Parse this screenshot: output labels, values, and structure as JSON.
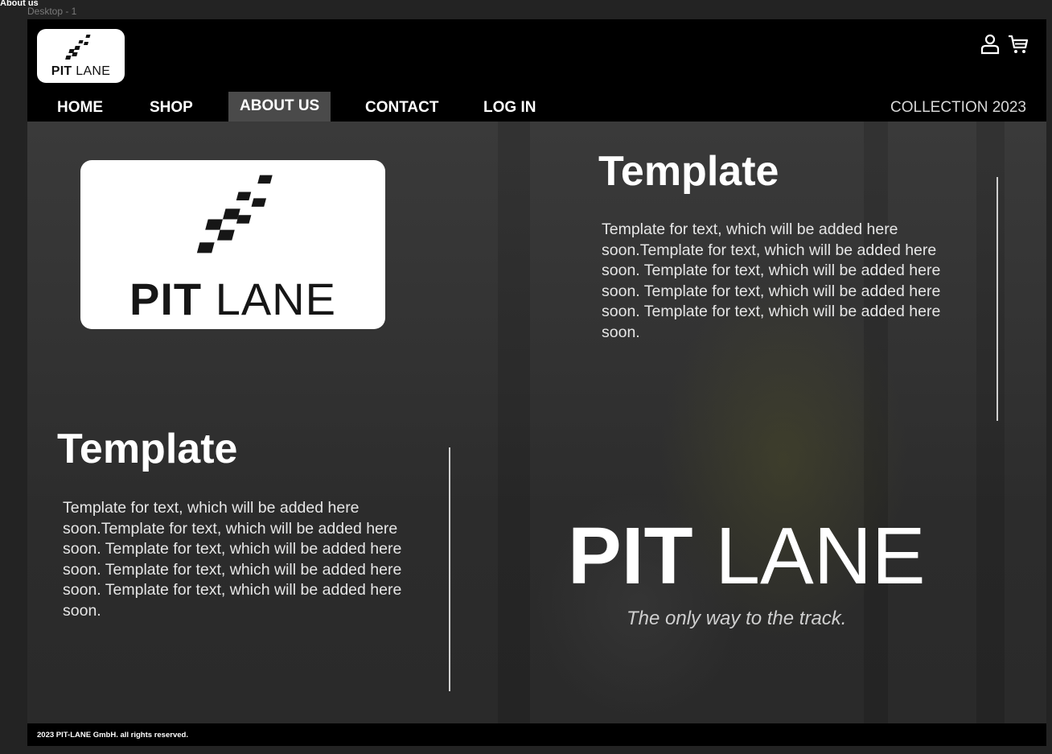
{
  "tool": {
    "page_label": "About us",
    "frame_label": "Desktop - 1"
  },
  "header": {
    "logo": {
      "bold": "PIT",
      "light": "LANE"
    },
    "icons": [
      "user-icon",
      "cart-icon"
    ]
  },
  "nav": {
    "items": [
      {
        "label": "HOME"
      },
      {
        "label": "SHOP"
      },
      {
        "label": "ABOUT US",
        "active": true
      },
      {
        "label": "CONTACT"
      },
      {
        "label": "LOG IN"
      }
    ],
    "collection": "COLLECTION 2023"
  },
  "hero": {
    "big_logo": {
      "bold": "PIT",
      "light": "LANE"
    },
    "section1": {
      "title": "Template",
      "text": "Template for text, which will be added here soon.Template for text, which will be added here soon. Template for text, which will be added here soon. Template for text, which will be added here soon. Template for text, which will be added here soon."
    },
    "section2": {
      "title": "Template",
      "text": "Template for text, which will be added here soon.Template for text, which will be added here soon. Template for text, which will be added here soon. Template for text, which will be added here soon. Template for text, which will be added here soon."
    },
    "brand": {
      "bold": "PIT",
      "light": "LANE",
      "tagline": "The only way to the track."
    }
  },
  "footer": {
    "text": "2023 PIT-LANE GmbH. all rights reserved."
  },
  "colors": {
    "background": "#000000",
    "active_tab": "#4a4a4a",
    "canvas": "#232323"
  }
}
